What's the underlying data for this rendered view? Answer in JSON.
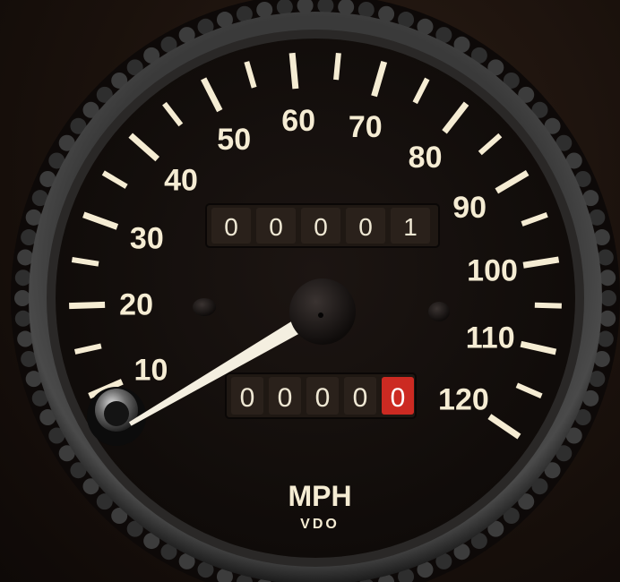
{
  "gauge": {
    "unit_label": "MPH",
    "brand_label": "VDO",
    "speed_labels": [
      "10",
      "20",
      "30",
      "40",
      "50",
      "60",
      "70",
      "80",
      "90",
      "100",
      "110",
      "120"
    ],
    "odometer_digits": [
      "0",
      "0",
      "0",
      "0",
      "1"
    ],
    "trip_digits": [
      "0",
      "0",
      "0",
      "0",
      "0"
    ],
    "needle_reading_mph": 0,
    "colors": {
      "face": "#15100d",
      "markings": "#f5ecd3",
      "bezel": "#2b2b2b",
      "trip_last_digit": "#cc2a22"
    }
  }
}
